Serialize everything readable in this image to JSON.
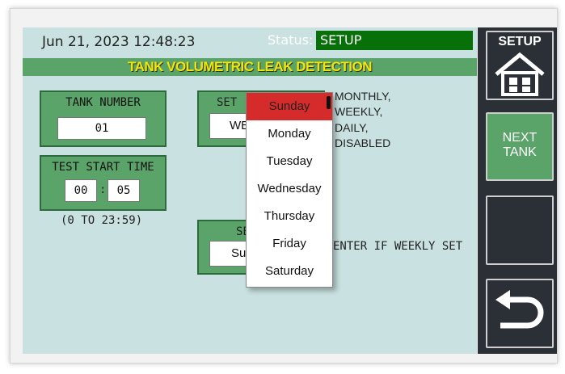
{
  "header": {
    "datetime": "Jun 21, 2023 12:48:23",
    "status_label": "Status:",
    "status_value": "SETUP"
  },
  "title": "TANK VOLUMETRIC LEAK DETECTION",
  "tank_number": {
    "label": "TANK NUMBER",
    "value": "01"
  },
  "test_start_time": {
    "label": "TEST START TIME",
    "hours": "00",
    "separator": ":",
    "minutes": "05",
    "range_note": "(0 TO 23:59)"
  },
  "set_mode": {
    "label_partial": "SET",
    "value_partial": "WE",
    "options_note": [
      "MONTHLY,",
      "WEEKLY,",
      "DAILY,",
      "DISABLED"
    ]
  },
  "set_day": {
    "label_partial": "SE",
    "value_partial": "Su",
    "note": "ENTER IF WEEKLY SET"
  },
  "dropdown": {
    "selected": "Sunday",
    "options": [
      "Sunday",
      "Monday",
      "Tuesday",
      "Wednesday",
      "Thursday",
      "Friday",
      "Saturday"
    ]
  },
  "sidebar": {
    "setup_label": "SETUP",
    "next_tank_line1": "NEXT",
    "next_tank_line2": "TANK"
  },
  "colors": {
    "accent_green": "#087008",
    "panel_green": "#5aa469",
    "title_yellow": "#f3e600",
    "background": "#c9e2e1",
    "selected_red": "#d62b2b"
  }
}
